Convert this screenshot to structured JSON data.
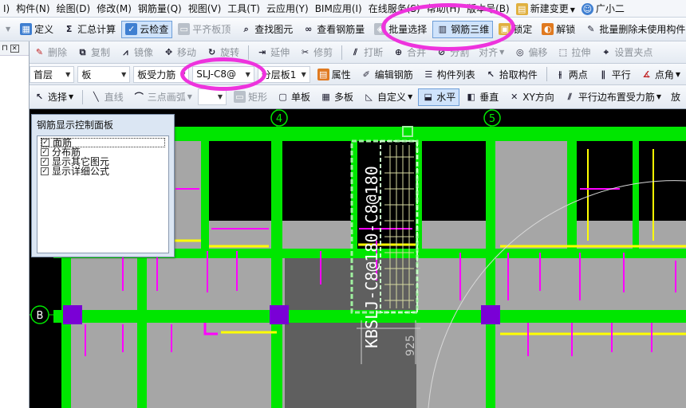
{
  "menubar": {
    "items": [
      "I)",
      "构件(N)",
      "绘图(D)",
      "修改(M)",
      "钢筋量(Q)",
      "视图(V)",
      "工具(T)",
      "云应用(Y)",
      "BIM应用(I)",
      "在线服务(S)",
      "帮助(H)",
      "版本号(B)",
      "新建变更",
      "广小二"
    ]
  },
  "toolbar1": {
    "items": [
      "定义",
      "汇总计算",
      "云检查",
      "平齐板顶",
      "查找图元",
      "查看钢筋量",
      "批量选择",
      "钢筋三维",
      "锁定",
      "解锁",
      "批量删除未使用构件"
    ]
  },
  "toolbar2": {
    "items": [
      "删除",
      "复制",
      "镜像",
      "移动",
      "旋转",
      "延伸",
      "修剪",
      "打断",
      "合并",
      "分割",
      "对齐",
      "偏移",
      "拉伸",
      "设置夹点"
    ]
  },
  "toolbar3": {
    "floor": "首层",
    "category": "板",
    "subcategory": "板受力筋",
    "component": "SLJ-C8@",
    "layer": "分层板1",
    "items": [
      "属性",
      "编辑钢筋",
      "构件列表",
      "拾取构件",
      "两点",
      "平行",
      "点角"
    ]
  },
  "toolbar4": {
    "items": [
      "选择",
      "直线",
      "三点画弧",
      "矩形",
      "单板",
      "多板",
      "自定义",
      "水平",
      "垂直",
      "XY方向",
      "平行边布置受力筋",
      "放"
    ]
  },
  "panel": {
    "title": "钢筋显示控制面板",
    "options": [
      {
        "label": "面筋",
        "checked": true
      },
      {
        "label": "分布筋",
        "checked": true
      },
      {
        "label": "显示其它图元",
        "checked": true
      },
      {
        "label": "显示详细公式",
        "checked": true
      }
    ]
  },
  "canvas": {
    "axis_labels": [
      "4",
      "5",
      "B"
    ],
    "rebar_label": "KBSLJ-C8@180-C8@180",
    "dimension_label": "925"
  },
  "colors": {
    "beam": "#00e600",
    "slab": "#a6a6a6",
    "rebar_magenta": "#ff00ff",
    "rebar_yellow": "#ffff00",
    "column": "#7a00d6",
    "callout": "#ee33dd",
    "active_button": "#cfe3fb"
  }
}
